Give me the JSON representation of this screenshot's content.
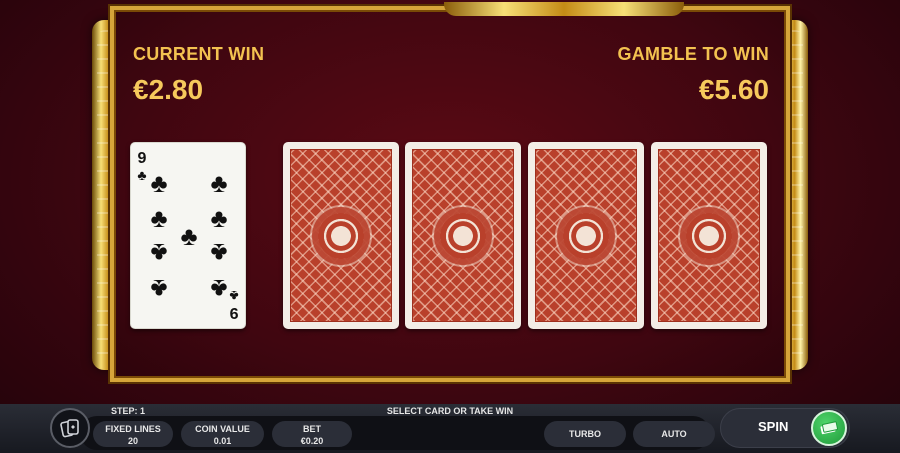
{
  "win": {
    "current_label": "CURRENT WIN",
    "current_value": "€2.80",
    "gamble_label": "GAMBLE TO WIN",
    "gamble_value": "€5.60"
  },
  "revealed_card": {
    "rank": "9",
    "suit": "♣",
    "suit_name": "clubs"
  },
  "hidden_cards": [
    "card-back",
    "card-back",
    "card-back",
    "card-back"
  ],
  "status": {
    "step": "STEP: 1",
    "instruction": "SELECT CARD OR TAKE WIN"
  },
  "controls": {
    "fixed_lines_label": "FIXED LINES",
    "fixed_lines_value": "20",
    "coin_value_label": "COIN VALUE",
    "coin_value_value": "0.01",
    "bet_label": "BET",
    "bet_value": "€0.20",
    "turbo_label": "TURBO",
    "auto_label": "AUTO",
    "spin_label": "SPIN"
  },
  "colors": {
    "gold": "#f3c250",
    "background": "#3d0610",
    "card_back": "#b9402b",
    "spin_green": "#1f9a3a"
  }
}
